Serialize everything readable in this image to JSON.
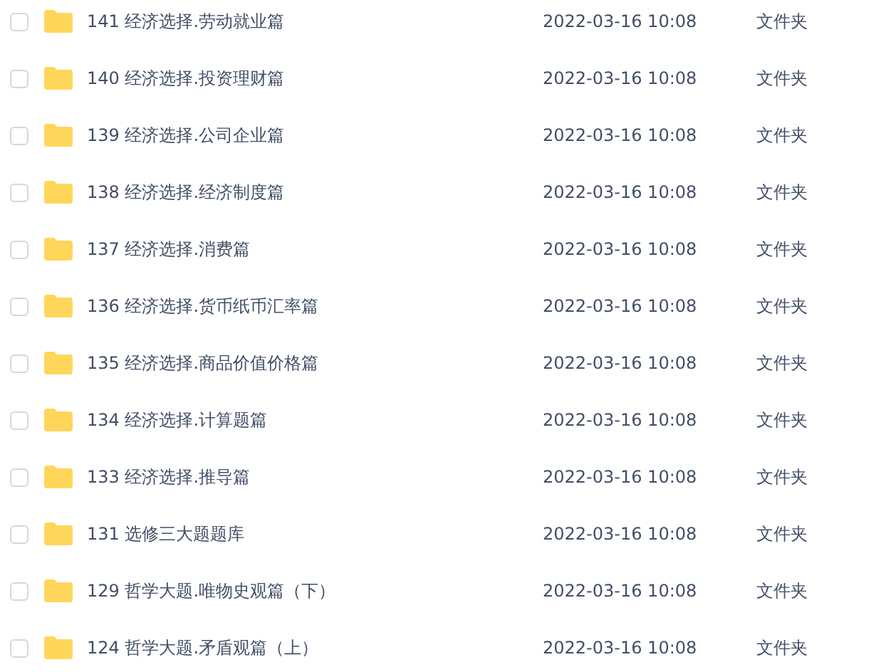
{
  "files": [
    {
      "name": "141 经济选择.劳动就业篇",
      "modified": "2022-03-16 10:08",
      "type": "文件夹",
      "checked": false
    },
    {
      "name": "140 经济选择.投资理财篇",
      "modified": "2022-03-16 10:08",
      "type": "文件夹",
      "checked": false
    },
    {
      "name": "139 经济选择.公司企业篇",
      "modified": "2022-03-16 10:08",
      "type": "文件夹",
      "checked": false
    },
    {
      "name": "138 经济选择.经济制度篇",
      "modified": "2022-03-16 10:08",
      "type": "文件夹",
      "checked": false
    },
    {
      "name": "137 经济选择.消费篇",
      "modified": "2022-03-16 10:08",
      "type": "文件夹",
      "checked": false
    },
    {
      "name": "136 经济选择.货币纸币汇率篇",
      "modified": "2022-03-16 10:08",
      "type": "文件夹",
      "checked": false
    },
    {
      "name": "135 经济选择.商品价值价格篇",
      "modified": "2022-03-16 10:08",
      "type": "文件夹",
      "checked": false
    },
    {
      "name": "134 经济选择.计算题篇",
      "modified": "2022-03-16 10:08",
      "type": "文件夹",
      "checked": false
    },
    {
      "name": "133 经济选择.推导篇",
      "modified": "2022-03-16 10:08",
      "type": "文件夹",
      "checked": false
    },
    {
      "name": "131 选修三大题题库",
      "modified": "2022-03-16 10:08",
      "type": "文件夹",
      "checked": false
    },
    {
      "name": "129 哲学大题.唯物史观篇（下）",
      "modified": "2022-03-16 10:08",
      "type": "文件夹",
      "checked": false
    },
    {
      "name": "124 哲学大题.矛盾观篇（上）",
      "modified": "2022-03-16 10:08",
      "type": "文件夹",
      "checked": false
    }
  ]
}
